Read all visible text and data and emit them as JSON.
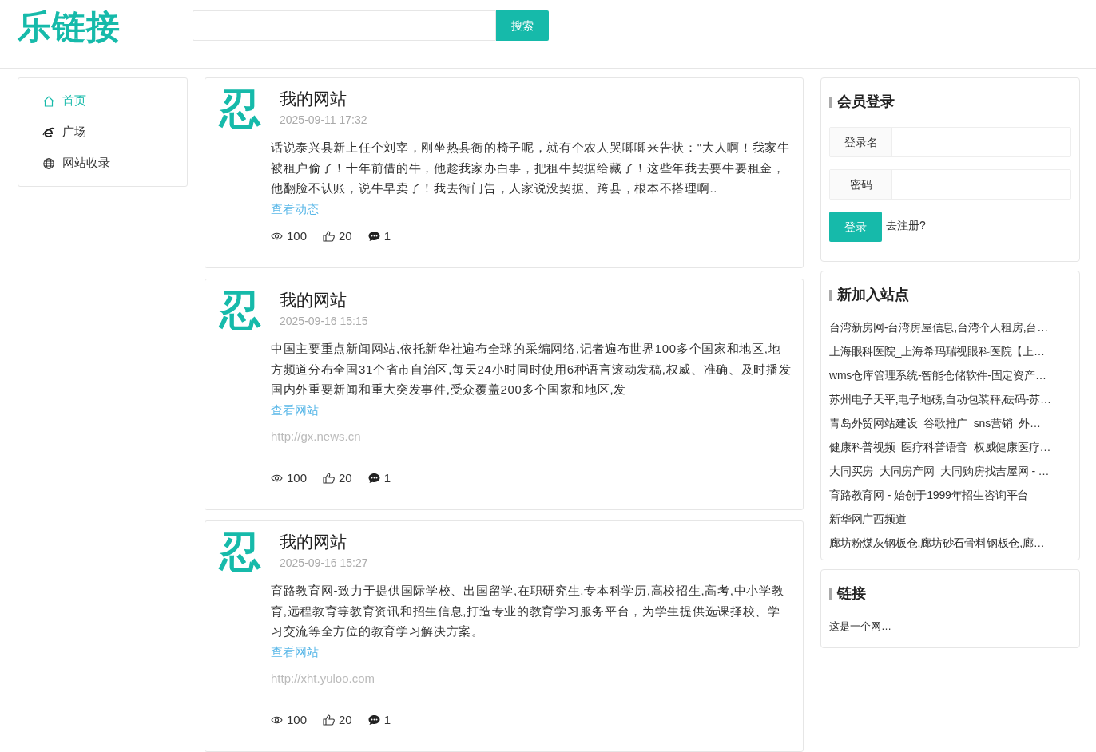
{
  "header": {
    "logo": "乐链接",
    "search": {
      "button": "搜索"
    }
  },
  "nav": [
    {
      "label": "首页",
      "selected": true
    },
    {
      "label": "广场",
      "selected": false
    },
    {
      "label": "网站收录",
      "selected": false
    }
  ],
  "posts": [
    {
      "avatar": "忍",
      "title": "我的网站",
      "date": "2025-09-11 17:32",
      "body": "话说泰兴县新上任个刘宰，刚坐热县衙的椅子呢，就有个农人哭唧唧来告状：\"大人啊！我家牛被租户偷了！十年前借的牛，他趁我家办白事，把租牛契据给藏了！这些年我去要牛要租金，他翻脸不认账，说牛早卖了！我去衙门告，人家说没契据、跨县，根本不搭理啊..",
      "link": "查看动态",
      "views": "100",
      "likes": "20",
      "comments": "1"
    },
    {
      "avatar": "忍",
      "title": "我的网站",
      "date": "2025-09-16 15:15",
      "body": "中国主要重点新闻网站,依托新华社遍布全球的采编网络,记者遍布世界100多个国家和地区,地方频道分布全国31个省市自治区,每天24小时同时使用6种语言滚动发稿,权威、准确、及时播发国内外重要新闻和重大突发事件,受众覆盖200多个国家和地区,发",
      "link": "查看网站",
      "url": "http://gx.news.cn",
      "views": "100",
      "likes": "20",
      "comments": "1"
    },
    {
      "avatar": "忍",
      "title": "我的网站",
      "date": "2025-09-16 15:27",
      "body": "育路教育网-致力于提供国际学校、出国留学,在职研究生,专本科学历,高校招生,高考,中小学教育,远程教育等教育资讯和招生信息,打造专业的教育学习服务平台，为学生提供选课择校、学习交流等全方位的教育学习解决方案。",
      "link": "查看网站",
      "url": "http://xht.yuloo.com",
      "views": "100",
      "likes": "20",
      "comments": "1"
    }
  ],
  "login": {
    "title": "会员登录",
    "username_label": "登录名",
    "password_label": "密码",
    "submit": "登录",
    "register": "去注册?"
  },
  "new_sites": {
    "title": "新加入站点",
    "items": [
      "台湾新房网-台湾房屋信息,台湾个人租房,台…",
      "上海眼科医院_上海希玛瑞视眼科医院【上…",
      "wms仓库管理系统-智能仓储软件-固定资产…",
      "苏州电子天平,电子地磅,自动包装秤,砝码-苏…",
      "青岛外贸网站建设_谷歌推广_sns营销_外…",
      "健康科普视频_医疗科普语音_权威健康医疗…",
      "大同买房_大同房产网_大同购房找吉屋网 - …",
      "育路教育网 - 始创于1999年招生咨询平台",
      "新华网广西频道",
      "廊坊粉煤灰钢板仓,廊坊砂石骨料钢板仓,廊…"
    ]
  },
  "links": {
    "title": "链接",
    "items": [
      "这是一个网…"
    ]
  }
}
